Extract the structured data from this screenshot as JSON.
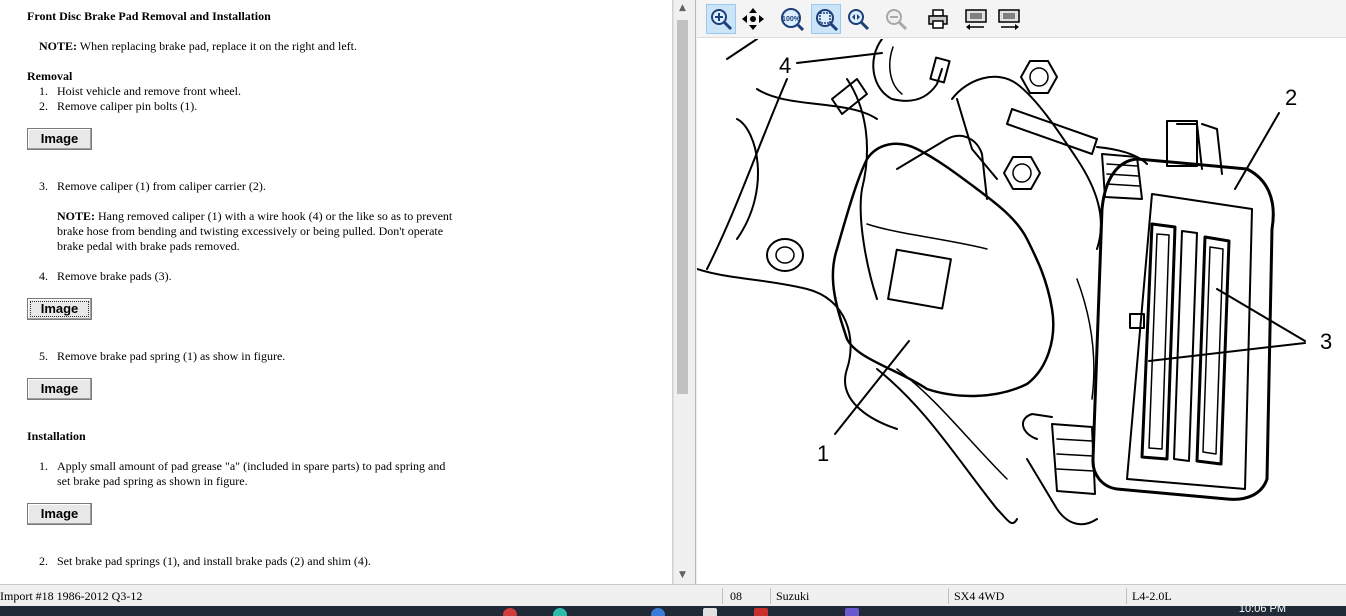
{
  "document": {
    "title": "Front Disc Brake Pad Removal and Installation",
    "note1_label": "NOTE:",
    "note1_text": " When replacing brake pad, replace it on the right and left.",
    "removal_heading": "Removal",
    "steps_a": [
      {
        "num": "1.",
        "text": "Hoist vehicle and remove front wheel."
      },
      {
        "num": "2.",
        "text": "Remove caliper pin bolts (1)."
      }
    ],
    "image_button_label": "Image",
    "step3": {
      "num": "3.",
      "text": "Remove caliper (1) from caliper carrier (2)."
    },
    "note2_label": "NOTE:",
    "note2_lines": [
      " Hang removed caliper (1) with a wire hook (4) or the like so as to prevent",
      "brake hose from bending and twisting excessively or being pulled. Don't operate",
      "brake pedal with brake pads removed."
    ],
    "step4": {
      "num": "4.",
      "text": "Remove brake pads (3)."
    },
    "step5": {
      "num": "5.",
      "text": "Remove brake pad spring (1) as show in figure."
    },
    "installation_heading": "Installation",
    "inst1": {
      "num": "1.",
      "lines": [
        "Apply small amount of pad grease \"a\" (included in spare parts) to pad spring and",
        "set brake pad spring as shown in figure."
      ]
    },
    "inst2": {
      "num": "2.",
      "text": "Set brake pad springs (1), and install brake pads (2) and shim (4)."
    }
  },
  "toolbar": {
    "buttons": [
      "zoom-in-icon",
      "pan-icon",
      "zoom-100-icon",
      "zoom-fit-icon",
      "zoom-window-icon",
      "zoom-out-icon",
      "print-icon",
      "previous-image-icon",
      "next-image-icon"
    ],
    "zoom_100_label": "100%"
  },
  "figure": {
    "callouts": {
      "c1": "1",
      "c2": "2",
      "c3": "3",
      "c4": "4"
    }
  },
  "statusbar": {
    "import": "Import #18 1986-2012 Q3-12",
    "year": "08",
    "make": "Suzuki",
    "model": "SX4 4WD",
    "engine": "L4-2.0L"
  },
  "taskbar": {
    "time": "10:06 PM"
  },
  "colors": {
    "active_button": "#cce4f7",
    "statusbar_bg": "#f0f0f0",
    "taskbar_bg": "#1f2a36"
  }
}
